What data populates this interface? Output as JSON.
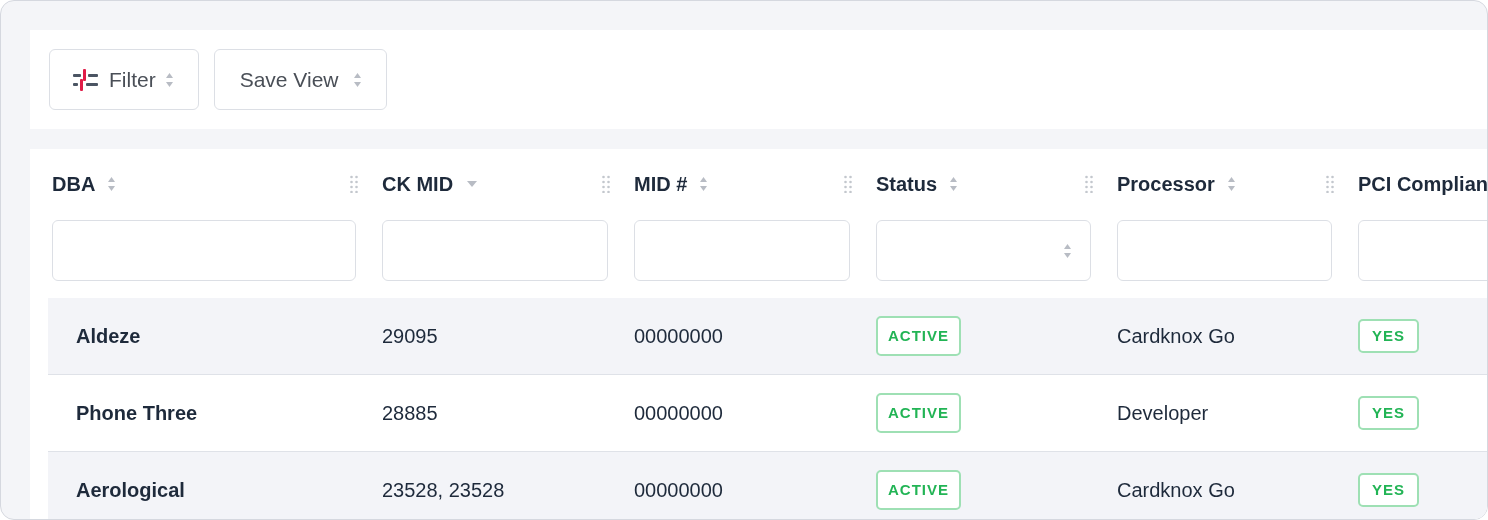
{
  "toolbar": {
    "buttons": [
      {
        "kind": "filter",
        "label": "Filter"
      },
      {
        "kind": "plain",
        "label": "Save View"
      }
    ]
  },
  "table": {
    "columns": [
      {
        "label": "DBA",
        "sorted_descending": false,
        "select_filter": false
      },
      {
        "label": "CK MID",
        "sorted_descending": true,
        "select_filter": false
      },
      {
        "label": "MID #",
        "sorted_descending": false,
        "select_filter": false
      },
      {
        "label": "Status",
        "sorted_descending": false,
        "select_filter": true
      },
      {
        "label": "Processor",
        "sorted_descending": false,
        "select_filter": false
      },
      {
        "label": "PCI Complian"
      }
    ],
    "rows": [
      {
        "cells": [
          "Aldeze",
          "29095",
          "00000000",
          "ACTIVE",
          "Cardknox Go",
          "YES"
        ]
      },
      {
        "cells": [
          "Phone Three",
          "28885",
          "00000000",
          "ACTIVE",
          "Developer",
          "YES"
        ]
      },
      {
        "cells": [
          "Aerological",
          "23528, 23528",
          "00000000",
          "ACTIVE",
          "Cardknox Go",
          "YES"
        ]
      }
    ]
  }
}
